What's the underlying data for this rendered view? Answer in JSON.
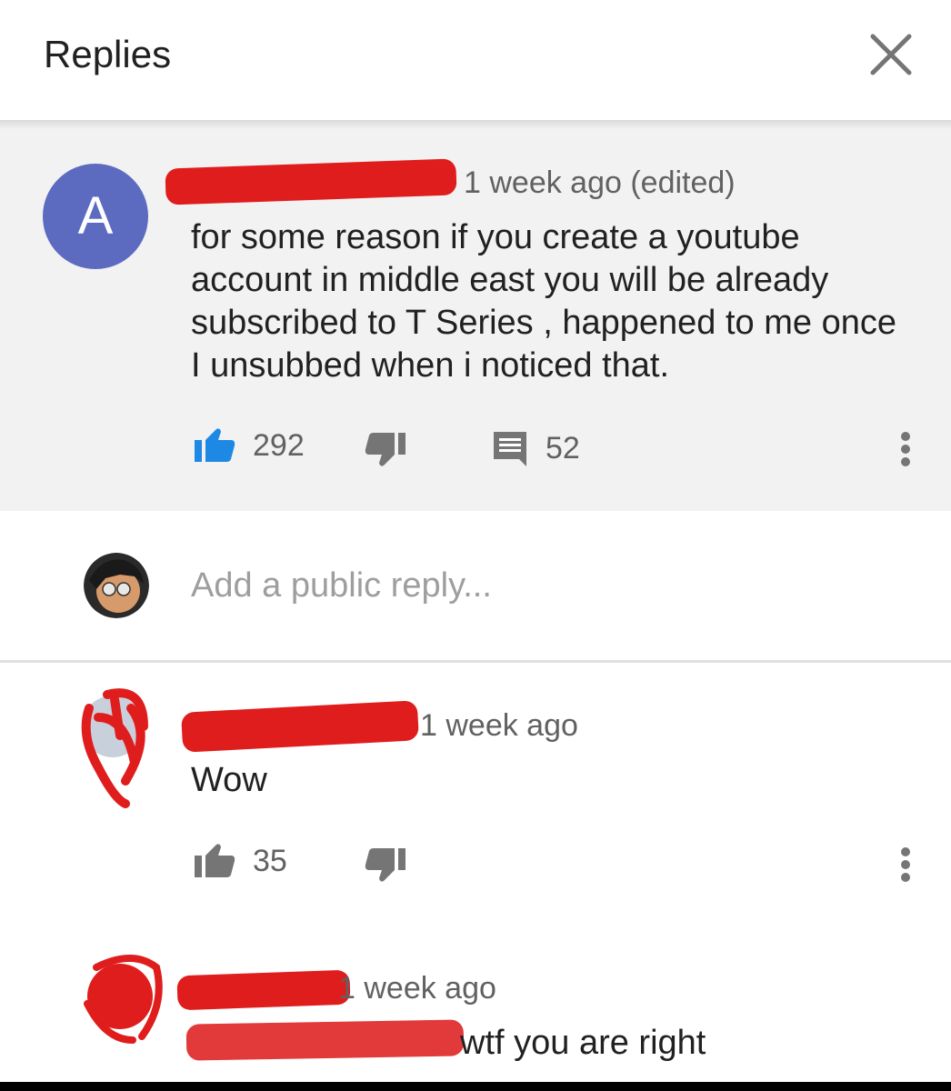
{
  "header": {
    "title": "Replies"
  },
  "parent_comment": {
    "avatar_letter": "A",
    "time": "1 week ago (edited)",
    "text": "for some reason if you create a youtube account in middle east you will be already subscribed to T Series , happened to me once I unsubbed when i noticed that.",
    "likes": "292",
    "reply_count": "52"
  },
  "reply_box": {
    "placeholder": "Add a public reply..."
  },
  "replies": [
    {
      "time": "1 week ago",
      "text": "Wow",
      "likes": "35"
    },
    {
      "time": "1 week ago",
      "text": "wtf you are right"
    }
  ],
  "colors": {
    "avatar": "#5c6bc0",
    "like_active": "#1e88e5",
    "redaction": "#e01d1d",
    "icon_gray": "#757575"
  }
}
